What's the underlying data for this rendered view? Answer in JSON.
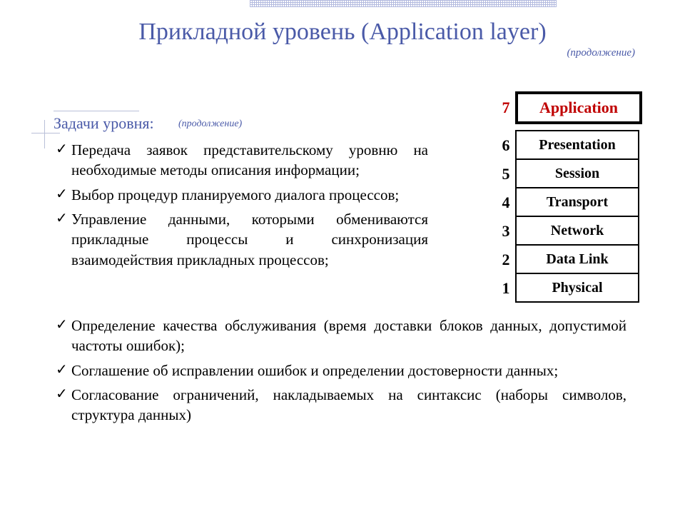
{
  "title": "Прикладной уровень (Application layer)",
  "continuation": "(продолжение)",
  "subtitle": "Задачи уровня:",
  "subtitle_cont": "(продолжение)",
  "tasks_upper": [
    "Передача заявок представительскому уровню на необходимые методы описания информации;",
    "Выбор процедур планируемого диалога процессов;",
    "Управление данными, которыми обмениваются прикладные процессы и синхронизация взаимодействия прикладных процессов;"
  ],
  "tasks_lower": [
    "Определение качества обслуживания (время доставки блоков данных, допустимой частоты ошибок);",
    "Соглашение об исправлении ошибок и определении достоверности данных;",
    "Согласование ограничений, накладываемых на синтаксис (наборы символов, структура данных)"
  ],
  "osi": [
    {
      "n": "7",
      "name": "Application",
      "hl": true
    },
    {
      "n": "6",
      "name": "Presentation",
      "hl": false
    },
    {
      "n": "5",
      "name": "Session",
      "hl": false
    },
    {
      "n": "4",
      "name": "Transport",
      "hl": false
    },
    {
      "n": "3",
      "name": "Network",
      "hl": false
    },
    {
      "n": "2",
      "name": "Data Link",
      "hl": false
    },
    {
      "n": "1",
      "name": "Physical",
      "hl": false
    }
  ],
  "check": "✓"
}
